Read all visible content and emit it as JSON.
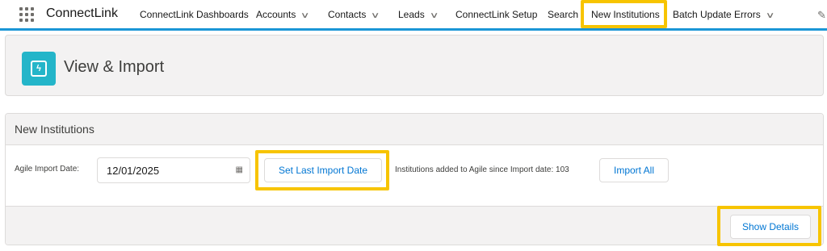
{
  "app": {
    "name": "ConnectLink"
  },
  "nav": {
    "items": [
      {
        "label": "ConnectLink Dashboards",
        "dropdown": false
      },
      {
        "label": "Accounts",
        "dropdown": true
      },
      {
        "label": "Contacts",
        "dropdown": true
      },
      {
        "label": "Leads",
        "dropdown": true
      },
      {
        "label": "ConnectLink Setup",
        "dropdown": false
      },
      {
        "label": "Search",
        "dropdown": false
      },
      {
        "label": "New Institutions",
        "dropdown": false,
        "highlighted": true
      },
      {
        "label": "Batch Update Errors",
        "dropdown": true
      }
    ],
    "chevron_glyph": "∨",
    "pencil_glyph": "✎"
  },
  "header": {
    "title": "View & Import",
    "icon": "bolt-icon",
    "icon_color": "#24b5c9"
  },
  "panel": {
    "title": "New Institutions",
    "import_date_label": "Agile Import Date:",
    "import_date_value": "12/01/2025",
    "calendar_glyph": "▦",
    "set_date_button": "Set Last Import Date",
    "info_text": "Institutions added to Agile since Import date: 103",
    "import_all_button": "Import All",
    "show_details_button": "Show Details"
  },
  "colors": {
    "accent": "#0176d3",
    "highlight": "#f7c400",
    "nav_border": "#1b96d6"
  }
}
